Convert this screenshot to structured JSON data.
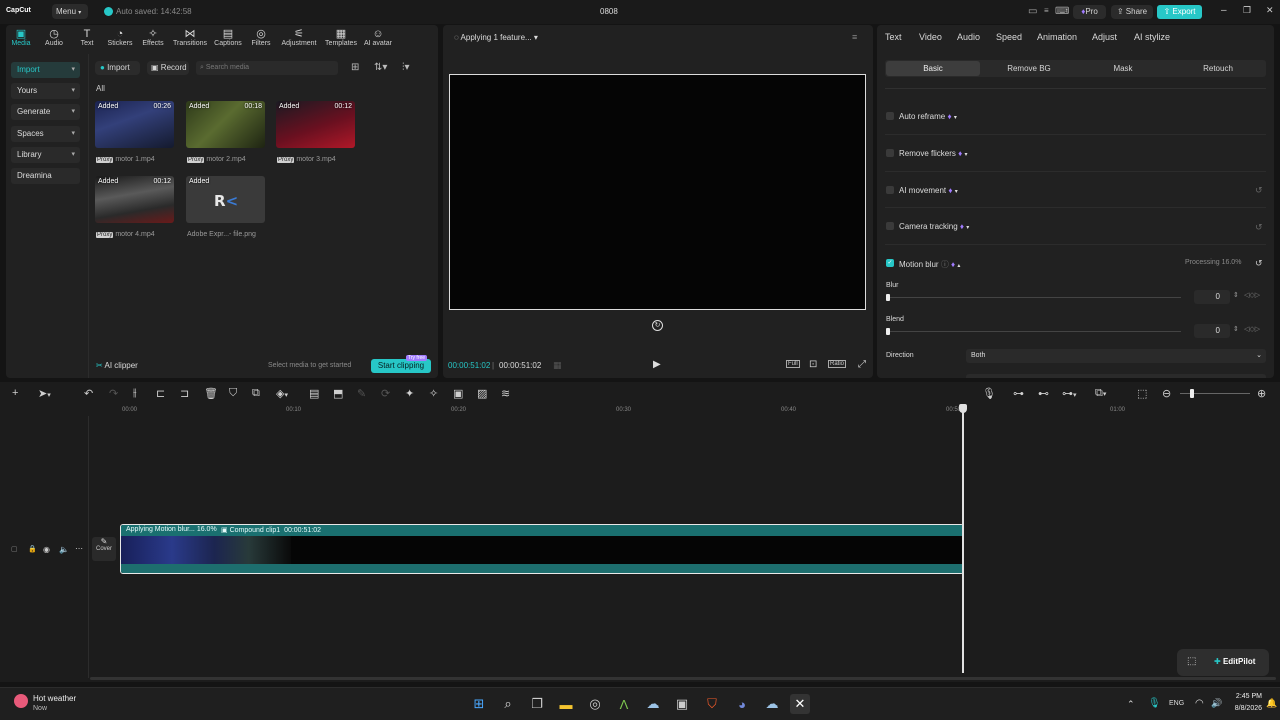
{
  "app": {
    "logo": "CapCut",
    "menu_label": "Menu",
    "autosave": "Auto saved: 14:42:58",
    "project_title": "0808",
    "pro_label": "Pro",
    "share_label": "Share",
    "export_label": "Export"
  },
  "media_tabs": [
    "Media",
    "Audio",
    "Text",
    "Stickers",
    "Effects",
    "Transitions",
    "Captions",
    "Filters",
    "Adjustment",
    "Templates",
    "AI avatar"
  ],
  "sidebar": [
    "Import",
    "Yours",
    "Generate",
    "Spaces",
    "Library",
    "Dreamina"
  ],
  "media_toolbar": {
    "import": "Import",
    "record": "Record",
    "search_placeholder": "Search media",
    "filter_all": "All"
  },
  "media_items": [
    {
      "status": "Added",
      "duration": "00:26",
      "proxy": "Proxy",
      "name": "motor 1.mp4"
    },
    {
      "status": "Added",
      "duration": "00:18",
      "proxy": "Proxy",
      "name": "motor 2.mp4"
    },
    {
      "status": "Added",
      "duration": "00:12",
      "proxy": "Proxy",
      "name": "motor 3.mp4"
    },
    {
      "status": "Added",
      "duration": "00:12",
      "proxy": "Proxy",
      "name": "motor 4.mp4"
    },
    {
      "status": "Added",
      "duration": "",
      "proxy": "",
      "name": "Adobe Expr...- file.png"
    }
  ],
  "clipper": {
    "label": "AI clipper",
    "hint": "Select media to get started",
    "button": "Start clipping",
    "badge": "Try free"
  },
  "player": {
    "status": "Applying 1 feature...",
    "current_time": "00:00:51:02",
    "total_time": "00:00:51:02",
    "full_label": "Full",
    "ratio_label": "Ratio"
  },
  "right_tabs": [
    "Text",
    "Video",
    "Audio",
    "Speed",
    "Animation",
    "Adjust",
    "AI stylize"
  ],
  "right_active_tab": "Video",
  "sub_tabs": [
    "Basic",
    "Remove BG",
    "Mask",
    "Retouch"
  ],
  "features": [
    {
      "label": "Auto reframe",
      "checked": false
    },
    {
      "label": "Remove flickers",
      "checked": false
    },
    {
      "label": "AI movement",
      "checked": false
    },
    {
      "label": "Camera tracking",
      "checked": false
    },
    {
      "label": "Motion blur",
      "checked": true
    }
  ],
  "motion_blur": {
    "processing": "Processing 16.0%",
    "blur_label": "Blur",
    "blur_value": "0",
    "blend_label": "Blend",
    "blend_value": "0",
    "direction_label": "Direction",
    "direction_value": "Both"
  },
  "timeline": {
    "ruler": [
      "00:00",
      "00:10",
      "00:20",
      "00:30",
      "00:40",
      "00:50",
      "01:00"
    ],
    "clip_status": "Applying Motion blur... 16.0%",
    "clip_name": "Compound clip1",
    "clip_duration": "00:00:51:02",
    "cover_label": "Cover"
  },
  "editpilot": "EditPilot",
  "taskbar": {
    "weather_title": "Hot weather",
    "weather_sub": "Now",
    "lang": "ENG",
    "time": "2:45 PM",
    "date": "8/8/2026"
  },
  "colors": {
    "accent": "#27c7c7",
    "bg": "#141414",
    "panel": "#212121"
  }
}
